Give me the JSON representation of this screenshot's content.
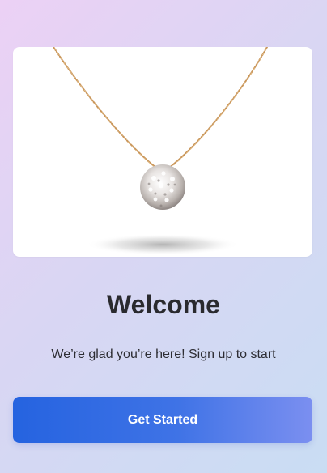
{
  "welcome": {
    "title": "Welcome",
    "subtitle": "We’re glad you’re here! Sign up to start",
    "cta_label": "Get Started"
  },
  "hero_image": {
    "subject": "necklace-pendant",
    "chain_color": "#c9965a",
    "card_background": "#ffffff"
  },
  "colors": {
    "background_start": "#ecd1f5",
    "background_end": "#c9ddf3",
    "button_start": "#2563e0",
    "button_end": "#7b8ff0",
    "title": "#2a2a2e",
    "subtitle": "#2d2d33"
  }
}
